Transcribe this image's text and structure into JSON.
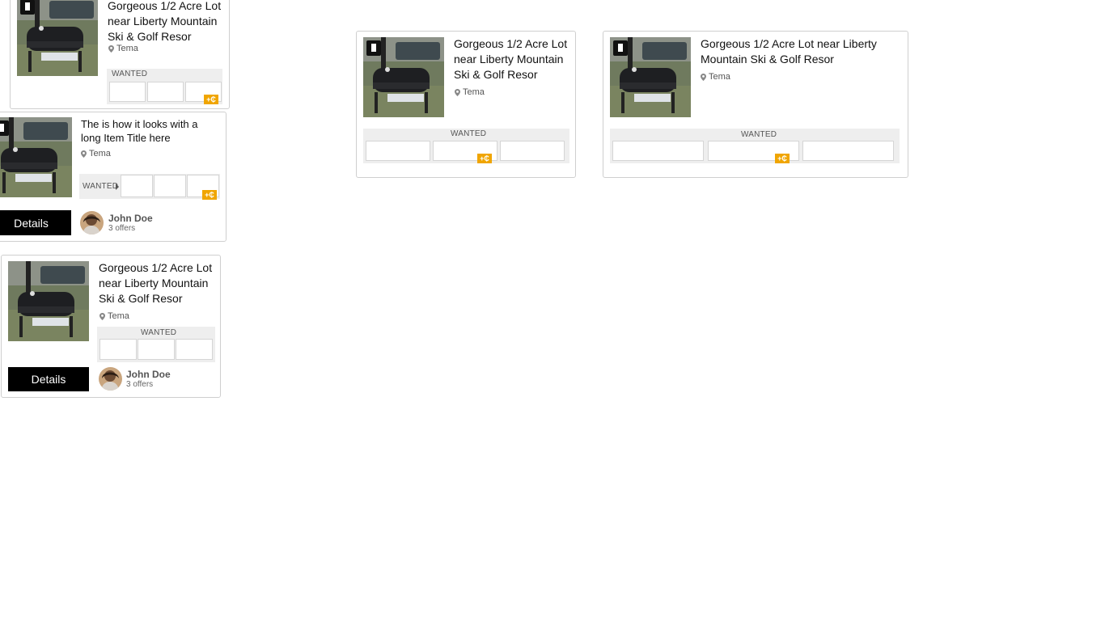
{
  "colors": {
    "accent": "#f0a500",
    "button_bg": "#000000",
    "border": "#cfcfcf"
  },
  "icons": {
    "location": "location-pin-icon",
    "bookmark": "bookmark-icon",
    "add": "add-coin-badge-icon"
  },
  "cards": [
    {
      "title": "Gorgeous 1/2 Acre Lot near Liberty Mountain Ski & Golf Resor",
      "location": "Tema",
      "wanted_label": "WANTED",
      "add_badge": "+₵"
    },
    {
      "title": "The is how it looks with a long Item Title here",
      "location": "Tema",
      "wanted_label": "WANTED",
      "add_badge": "+₵",
      "details_label": "Details",
      "user_name": "John Doe",
      "user_offers": "3 offers"
    },
    {
      "title": "Gorgeous 1/2 Acre Lot near Liberty Mountain Ski & Golf Resor",
      "location": "Tema",
      "wanted_label": "WANTED",
      "details_label": "Details",
      "user_name": "John Doe",
      "user_offers": "3 offers"
    },
    {
      "title": "Gorgeous 1/2 Acre Lot near Liberty Mountain Ski & Golf Resor",
      "location": "Tema",
      "wanted_label": "WANTED",
      "add_badge": "+₵"
    },
    {
      "title": "Gorgeous 1/2 Acre Lot near Liberty Mountain Ski & Golf Resor",
      "location": "Tema",
      "wanted_label": "WANTED",
      "add_badge": "+₵"
    }
  ]
}
